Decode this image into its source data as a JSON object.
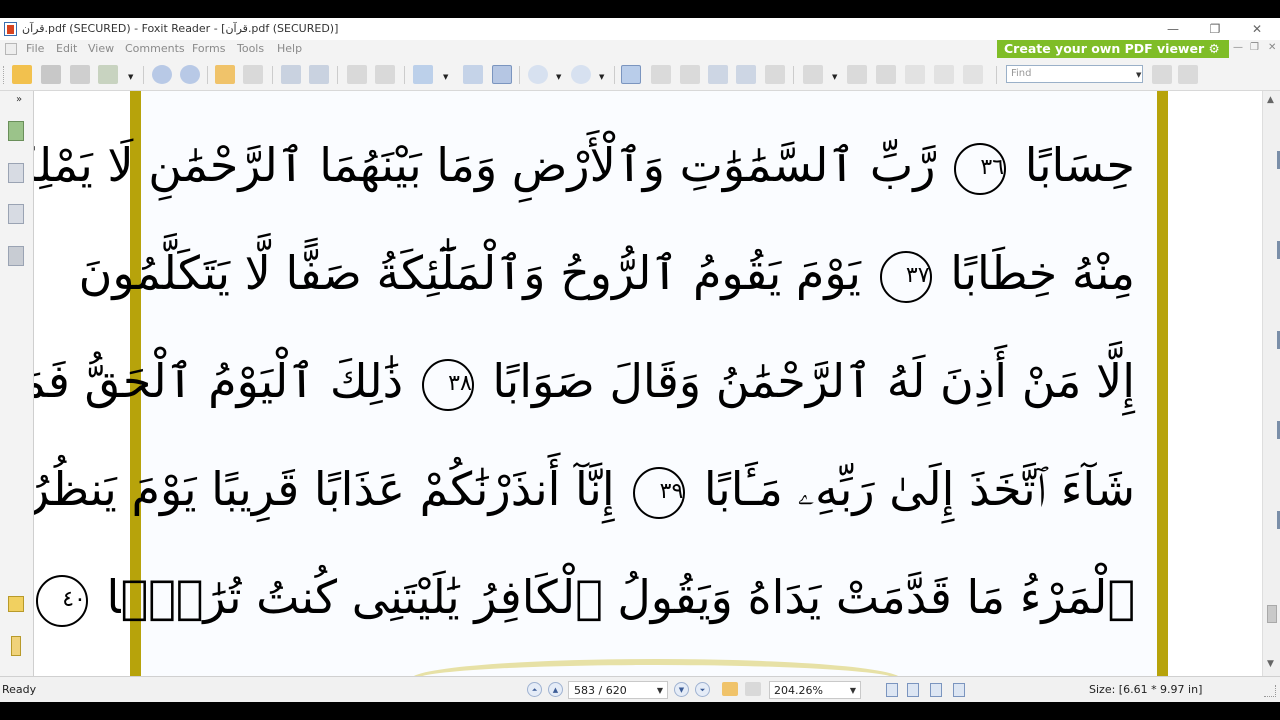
{
  "window": {
    "title": "قرآن.pdf (SECURED) - Foxit Reader - [قرآن.pdf (SECURED)]",
    "controls": {
      "minimize": "—",
      "restore": "❐",
      "close": "✕"
    }
  },
  "menu": {
    "items": [
      "File",
      "Edit",
      "View",
      "Comments",
      "Forms",
      "Tools",
      "Help"
    ],
    "banner": "Create your own PDF viewer ⚙"
  },
  "toolbar": {
    "find_placeholder": "Find"
  },
  "document": {
    "lines": [
      "حِسَابًا ٣٦ رَّبِّ ٱلسَّمَٰوَٰتِ وَٱلْأَرْضِ وَمَا بَيْنَهُمَا ٱلرَّحْمَٰنِ لَا يَمْلِكُونَ",
      "مِنْهُ خِطَابًا ٣٧ يَوْمَ يَقُومُ ٱلرُّوحُ وَٱلْمَلَٰٓئِكَةُ صَفًّا لَّا يَتَكَلَّمُونَ",
      "إِلَّا مَنْ أَذِنَ لَهُ ٱلرَّحْمَٰنُ وَقَالَ صَوَابًا ٣٨ ذَٰلِكَ ٱلْيَوْمُ ٱلْحَقُّ فَمَن",
      "شَآءَ ٱتَّخَذَ إِلَىٰ رَبِّهِۦ مَـَٔابًا ٣٩ إِنَّآ أَنذَرْنَٰكُمْ عَذَابًا قَرِيبًا يَوْمَ يَنظُرُ",
      "ٱلْمَرْءُ مَا قَدَّمَتْ يَدَاهُ وَيَقُولُ ٱلْكَافِرُ يَٰلَيْتَنِى كُنتُ تُرَٰبًۢا ٤٠"
    ],
    "ayah_markers": [
      "٣٦",
      "٣٧",
      "٣٨",
      "٣٩",
      "٤٠"
    ]
  },
  "status": {
    "text": "Ready",
    "page": "583 / 620",
    "zoom": "204.26%",
    "size": "Size: [6.61 * 9.97 in]"
  }
}
